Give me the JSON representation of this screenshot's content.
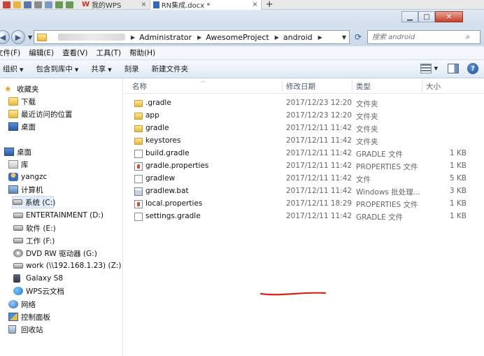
{
  "colors": {
    "accent": "#3a6ea5",
    "annotation_underline": "#d6221c",
    "close_button": "#c9402a"
  },
  "tabs": [
    {
      "label": "我的WPS",
      "icon": "wps-icon"
    },
    {
      "label": "RN集成.docx *",
      "icon": "doc-icon"
    }
  ],
  "tab_close": "×",
  "new_tab": "+",
  "window": {
    "minimize": "▁",
    "maximize": "□",
    "close": "✕"
  },
  "address": {
    "crumbs": [
      "Administrator",
      "AwesomeProject",
      "android"
    ],
    "search_placeholder": "搜索 android"
  },
  "menu": [
    "文件(F)",
    "编辑(E)",
    "查看(V)",
    "工具(T)",
    "帮助(H)"
  ],
  "toolbar": {
    "organize": "组织",
    "include_library": "包含到库中",
    "share": "共享",
    "burn": "刻录",
    "new_folder": "新建文件夹"
  },
  "nav": {
    "favorites": "收藏夹",
    "downloads": "下载",
    "recent": "最近访问的位置",
    "desktop_fav": "桌面",
    "desktop": "桌面",
    "libraries": "库",
    "user": "yangzc",
    "computer": "计算机",
    "drive_c": "系统 (C:)",
    "drive_d": "ENTERTAINMENT (D:)",
    "drive_e": "软件 (E:)",
    "drive_f": "工作 (F:)",
    "drive_g": "DVD RW 驱动器 (G:)",
    "drive_z": "work (\\\\192.168.1.23) (Z:)",
    "galaxy": "Galaxy S8",
    "wps_cloud": "WPS云文档",
    "network": "网络",
    "control_panel": "控制面板",
    "recycle_bin": "回收站"
  },
  "columns": {
    "name": "名称",
    "date": "修改日期",
    "type": "类型",
    "size": "大小"
  },
  "files": [
    {
      "name": ".gradle",
      "date": "2017/12/23 12:20",
      "type": "文件夹",
      "size": "",
      "icon": "folder-icon"
    },
    {
      "name": "app",
      "date": "2017/12/23 12:20",
      "type": "文件夹",
      "size": "",
      "icon": "folder-icon"
    },
    {
      "name": "gradle",
      "date": "2017/12/11 11:42",
      "type": "文件夹",
      "size": "",
      "icon": "folder-icon"
    },
    {
      "name": "keystores",
      "date": "2017/12/11 11:42",
      "type": "文件夹",
      "size": "",
      "icon": "folder-icon"
    },
    {
      "name": "build.gradle",
      "date": "2017/12/11 11:42",
      "type": "GRADLE 文件",
      "size": "1 KB",
      "icon": "file-icon"
    },
    {
      "name": "gradle.properties",
      "date": "2017/12/11 11:42",
      "type": "PROPERTIES 文件",
      "size": "1 KB",
      "icon": "properties-file-icon"
    },
    {
      "name": "gradlew",
      "date": "2017/12/11 11:42",
      "type": "文件",
      "size": "5 KB",
      "icon": "file-icon"
    },
    {
      "name": "gradlew.bat",
      "date": "2017/12/11 11:42",
      "type": "Windows 批处理...",
      "size": "3 KB",
      "icon": "batch-file-icon"
    },
    {
      "name": "local.properties",
      "date": "2017/12/11 18:29",
      "type": "PROPERTIES 文件",
      "size": "1 KB",
      "icon": "properties-file-icon"
    },
    {
      "name": "settings.gradle",
      "date": "2017/12/11 11:42",
      "type": "GRADLE 文件",
      "size": "1 KB",
      "icon": "file-icon"
    }
  ]
}
